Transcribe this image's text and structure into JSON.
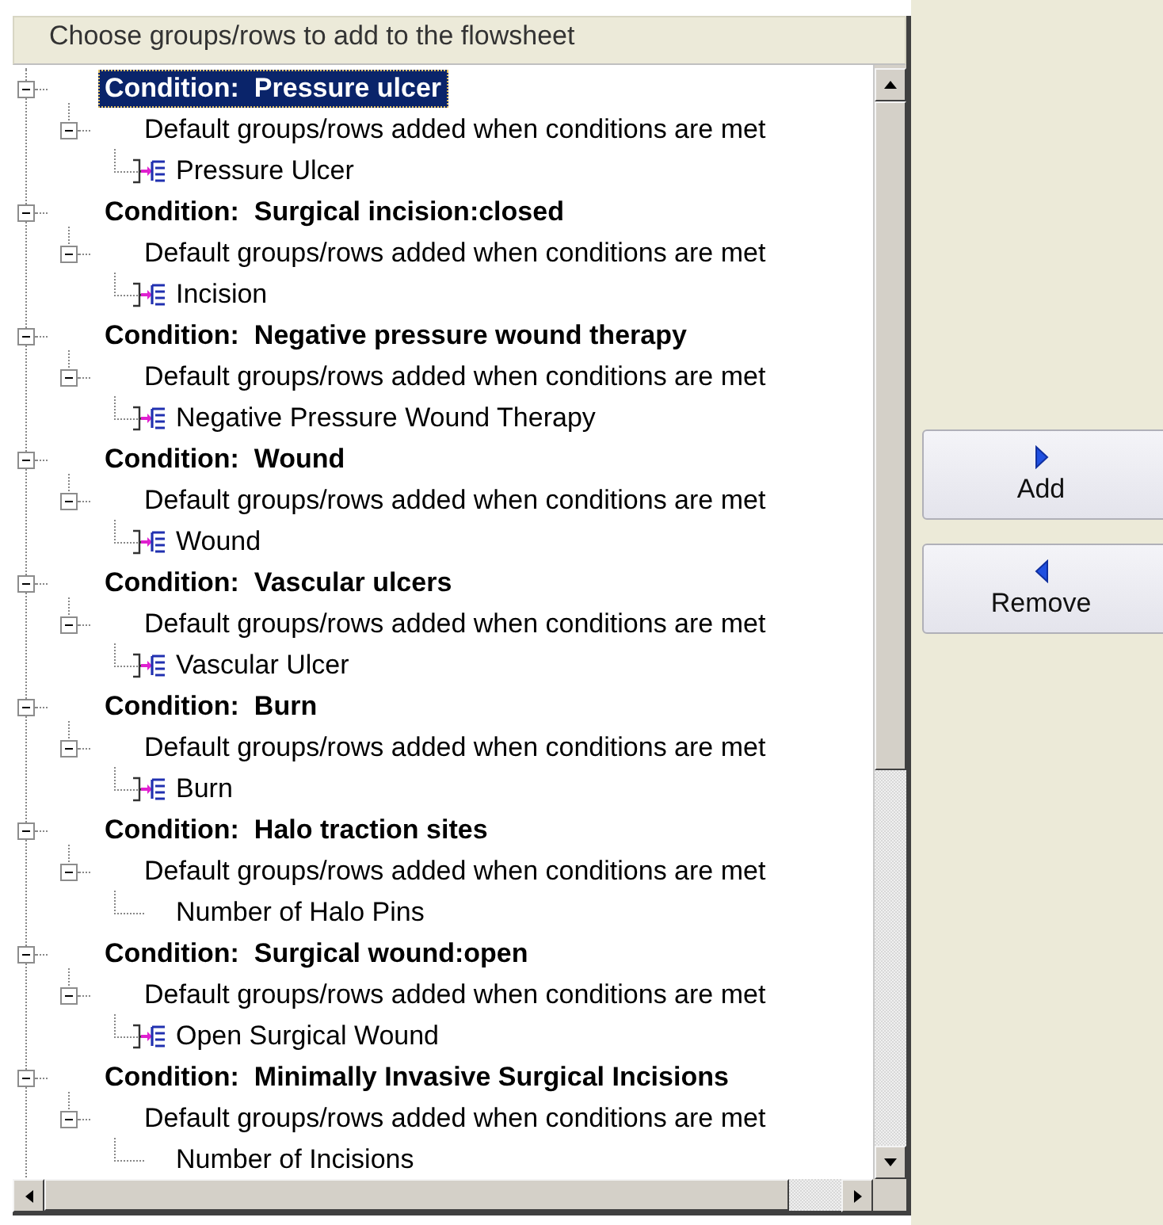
{
  "panel": {
    "title": "Choose groups/rows to add to the flowsheet"
  },
  "conditions": [
    {
      "label": "Condition:  Pressure ulcer",
      "selected": true,
      "expanded": true,
      "children": [
        {
          "label": "Default groups/rows added when conditions are met",
          "expanded": true,
          "children": [
            {
              "label": "Pressure Ulcer",
              "kind": "group"
            }
          ]
        }
      ]
    },
    {
      "label": "Condition:  Surgical incision:closed",
      "selected": false,
      "expanded": true,
      "children": [
        {
          "label": "Default groups/rows added when conditions are met",
          "expanded": true,
          "children": [
            {
              "label": "Incision",
              "kind": "group"
            }
          ]
        }
      ]
    },
    {
      "label": "Condition:  Negative pressure wound therapy",
      "selected": false,
      "expanded": true,
      "children": [
        {
          "label": "Default groups/rows added when conditions are met",
          "expanded": true,
          "children": [
            {
              "label": "Negative Pressure Wound Therapy",
              "kind": "group"
            }
          ]
        }
      ]
    },
    {
      "label": "Condition:  Wound",
      "selected": false,
      "expanded": true,
      "children": [
        {
          "label": "Default groups/rows added when conditions are met",
          "expanded": true,
          "children": [
            {
              "label": "Wound",
              "kind": "group"
            }
          ]
        }
      ]
    },
    {
      "label": "Condition:  Vascular ulcers",
      "selected": false,
      "expanded": true,
      "children": [
        {
          "label": "Default groups/rows added when conditions are met",
          "expanded": true,
          "children": [
            {
              "label": "Vascular Ulcer",
              "kind": "group"
            }
          ]
        }
      ]
    },
    {
      "label": "Condition:  Burn",
      "selected": false,
      "expanded": true,
      "children": [
        {
          "label": "Default groups/rows added when conditions are met",
          "expanded": true,
          "children": [
            {
              "label": "Burn",
              "kind": "group"
            }
          ]
        }
      ]
    },
    {
      "label": "Condition:  Halo traction sites",
      "selected": false,
      "expanded": true,
      "children": [
        {
          "label": "Default groups/rows added when conditions are met",
          "expanded": true,
          "children": [
            {
              "label": "Number of Halo Pins",
              "kind": "row"
            }
          ]
        }
      ]
    },
    {
      "label": "Condition:  Surgical wound:open",
      "selected": false,
      "expanded": true,
      "children": [
        {
          "label": "Default groups/rows added when conditions are met",
          "expanded": true,
          "children": [
            {
              "label": "Open Surgical Wound",
              "kind": "group"
            }
          ]
        }
      ]
    },
    {
      "label": "Condition:  Minimally Invasive Surgical Incisions",
      "selected": false,
      "expanded": true,
      "children": [
        {
          "label": "Default groups/rows added when conditions are met",
          "expanded": true,
          "children": [
            {
              "label": "Number of Incisions",
              "kind": "row"
            }
          ]
        }
      ]
    }
  ],
  "buttons": [
    {
      "label": "Add",
      "kind": "add"
    },
    {
      "label": "Remove",
      "kind": "remove"
    }
  ]
}
